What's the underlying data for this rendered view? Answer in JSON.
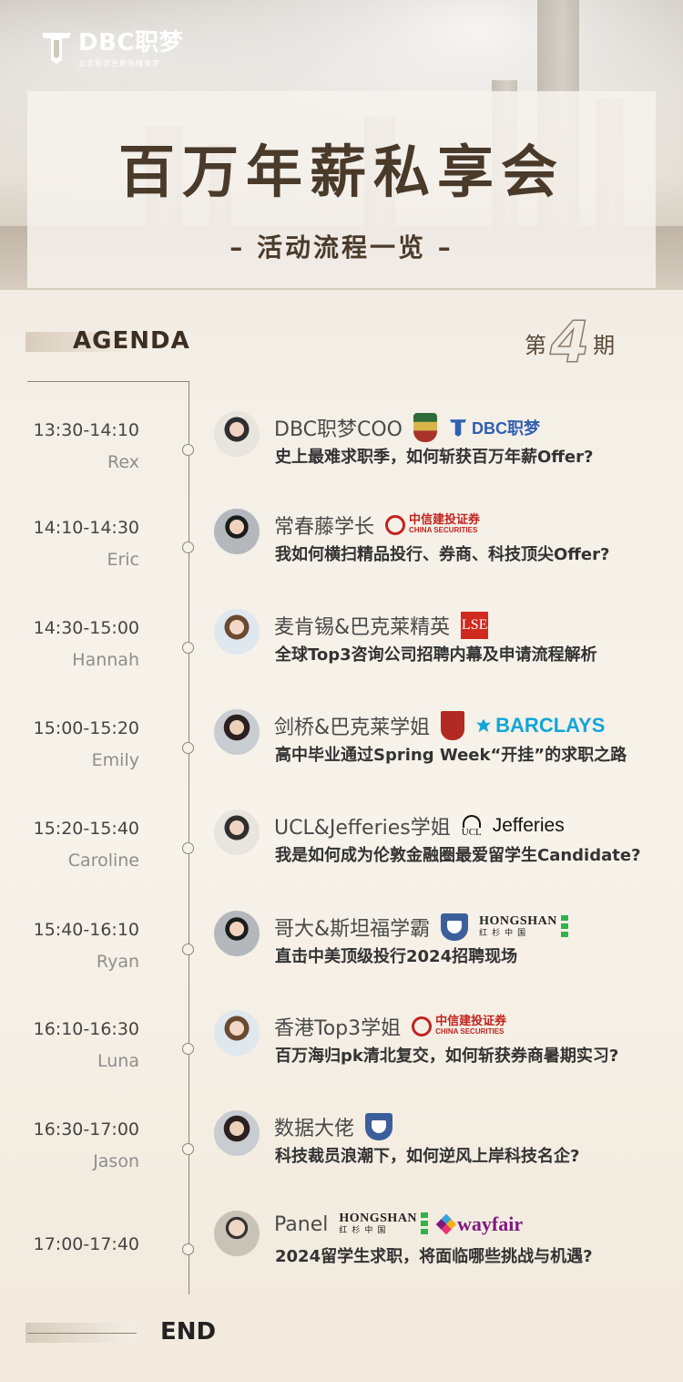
{
  "brand": {
    "name": "DBC职梦",
    "tagline": "立志留学生职场精英梦"
  },
  "title": "百万年薪私享会",
  "subtitle": "– 活动流程一览 –",
  "agenda_label": "AGENDA",
  "issue": {
    "prefix": "第",
    "number": "4",
    "suffix": "期"
  },
  "end_label": "END",
  "sessions": [
    {
      "time": "13:30-14:10",
      "name": "Rex",
      "speaker": "DBC职梦COO",
      "topic": "史上最难求职季，如何斩获百万年薪Offer?",
      "badges": [
        "hku-crest",
        "DBC职梦"
      ]
    },
    {
      "time": "14:10-14:30",
      "name": "Eric",
      "speaker": "常春藤学长",
      "topic": "我如何横扫精品投行、券商、科技顶尖Offer?",
      "badges": [
        "中信建投证券"
      ]
    },
    {
      "time": "14:30-15:00",
      "name": "Hannah",
      "speaker": "麦肯锡&巴克莱精英",
      "topic": "全球Top3咨询公司招聘内幕及申请流程解析",
      "badges": [
        "LSE"
      ]
    },
    {
      "time": "15:00-15:20",
      "name": "Emily",
      "speaker": "剑桥&巴克莱学姐",
      "topic": "高中毕业通过Spring Week“开挂”的求职之路",
      "badges": [
        "cambridge-crest",
        "BARCLAYS"
      ]
    },
    {
      "time": "15:20-15:40",
      "name": "Caroline",
      "speaker": "UCL&Jefferies学姐",
      "topic": "我是如何成为伦敦金融圈最爱留学生Candidate?",
      "badges": [
        "UCL",
        "Jefferies"
      ]
    },
    {
      "time": "15:40-16:10",
      "name": "Ryan",
      "speaker": "哥大&斯坦福学霸",
      "topic": "直击中美顶级投行2024招聘现场",
      "badges": [
        "columbia-crest",
        "HONGSHAN"
      ]
    },
    {
      "time": "16:10-16:30",
      "name": "Luna",
      "speaker": "香港Top3学姐",
      "topic": "百万海归pk清北复交，如何斩获券商暑期实习?",
      "badges": [
        "中信建投证券"
      ]
    },
    {
      "time": "16:30-17:00",
      "name": "Jason",
      "speaker": "数据大佬",
      "topic": "科技裁员浪潮下，如何逆风上岸科技名企?",
      "badges": [
        "columbia-crest"
      ]
    },
    {
      "time": "17:00-17:40",
      "name": "",
      "speaker": "Panel",
      "topic": "2024留学生求职，将面临哪些挑战与机遇?",
      "badges": [
        "HONGSHAN",
        "wayfair"
      ]
    }
  ],
  "logos": {
    "dbc": "DBC职梦",
    "citic": "中信建投证券",
    "citic_en": "CHINA SECURITIES",
    "lse": "LSE",
    "barclays": "BARCLAYS",
    "ucl": "UCL",
    "jefferies": "Jefferies",
    "hongshan": "HONGSHAN",
    "hongshan_cn": "红杉中国",
    "wayfair": "wayfair"
  }
}
